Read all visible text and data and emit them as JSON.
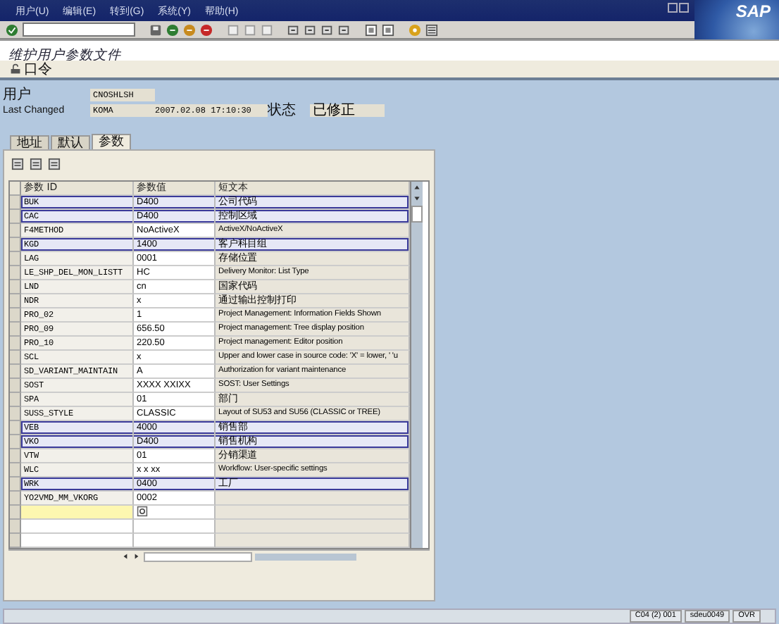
{
  "menu": [
    {
      "label": "用户(U)"
    },
    {
      "label": "编辑(E)"
    },
    {
      "label": "转到(G)"
    },
    {
      "label": "系统(Y)"
    },
    {
      "label": "帮助(H)"
    }
  ],
  "logo": "SAP",
  "title": "维护用户参数文件",
  "app_toolbar": [
    {
      "label": "口令"
    }
  ],
  "header": {
    "user_label": "用户",
    "user": "CNOSHLSH",
    "changed_label": "Last Changed",
    "changed_by": "KOMA",
    "changed_at": "2007.02.08 17:10:30",
    "status_label": "状态",
    "status": "已修正"
  },
  "tabs": [
    {
      "label": "地址",
      "selected": false
    },
    {
      "label": "默认",
      "selected": false
    },
    {
      "label": "参数",
      "selected": true
    }
  ],
  "table": {
    "columns": [
      "参数 ID",
      "参数值",
      "短文本"
    ],
    "rows": [
      {
        "id": "BUK",
        "value": "D400",
        "text": "公司代码",
        "highlighted": true
      },
      {
        "id": "CAC",
        "value": "D400",
        "text": "控制区域",
        "highlighted": true
      },
      {
        "id": "F4METHOD",
        "value": "NoActiveX",
        "text": "ActiveX/NoActiveX",
        "highlighted": false
      },
      {
        "id": "KGD",
        "value": "1400",
        "text": "客户科目组",
        "highlighted": true
      },
      {
        "id": "LAG",
        "value": "0001",
        "text": "存储位置",
        "highlighted": false
      },
      {
        "id": "LE_SHP_DEL_MON_LISTT",
        "value": "HC",
        "text": "Delivery Monitor: List Type",
        "highlighted": false
      },
      {
        "id": "LND",
        "value": "cn",
        "text": "国家代码",
        "highlighted": false
      },
      {
        "id": "NDR",
        "value": "x",
        "text": "通过输出控制打印",
        "highlighted": false
      },
      {
        "id": "PRO_02",
        "value": "1",
        "text": "Project Management: Information Fields Shown",
        "highlighted": false
      },
      {
        "id": "PRO_09",
        "value": "656.50",
        "text": "Project management: Tree display position",
        "highlighted": false
      },
      {
        "id": "PRO_10",
        "value": "220.50",
        "text": "Project management: Editor position",
        "highlighted": false
      },
      {
        "id": "SCL",
        "value": "x",
        "text": "Upper and lower case in source code: 'X' = lower, ' 'u",
        "highlighted": false
      },
      {
        "id": "SD_VARIANT_MAINTAIN",
        "value": "A",
        "text": "Authorization for variant maintenance",
        "highlighted": false
      },
      {
        "id": "SOST",
        "value": "XXXX  XXIXX",
        "text": "SOST: User Settings",
        "highlighted": false
      },
      {
        "id": "SPA",
        "value": "01",
        "text": "部门",
        "highlighted": false
      },
      {
        "id": "SUSS_STYLE",
        "value": "CLASSIC",
        "text": "Layout of SU53 and SU56 (CLASSIC or TREE)",
        "highlighted": false
      },
      {
        "id": "VEB",
        "value": "4000",
        "text": "销售部",
        "highlighted": true
      },
      {
        "id": "VKO",
        "value": "D400",
        "text": "销售机构",
        "highlighted": true
      },
      {
        "id": "VTW",
        "value": "01",
        "text": "分销渠道",
        "highlighted": false
      },
      {
        "id": "WLC",
        "value": "x x xx",
        "text": "Workflow: User-specific settings",
        "highlighted": false
      },
      {
        "id": "WRK",
        "value": "0400",
        "text": "工厂",
        "highlighted": true
      },
      {
        "id": "YO2VMD_MM_VKORG",
        "value": "0002",
        "text": "",
        "highlighted": false
      }
    ]
  },
  "status_bar": [
    "C04 (2) 001",
    "sdeu0049",
    "OVR"
  ]
}
